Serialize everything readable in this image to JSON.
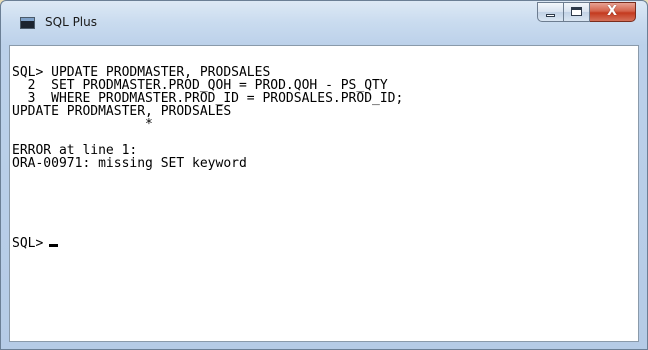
{
  "window": {
    "title": "SQL Plus",
    "app_icon": "console-window-icon",
    "controls": {
      "minimize_icon": "minimize-icon",
      "maximize_icon": "maximize-icon",
      "close_icon": "close-icon",
      "close_glyph": "X"
    }
  },
  "console": {
    "lines": [
      "SQL> UPDATE PRODMASTER, PRODSALES",
      "  2  SET PRODMASTER.PROD_QOH = PROD.QOH - PS_QTY",
      "  3  WHERE PRODMASTER.PROD_ID = PRODSALES.PROD_ID;",
      "UPDATE PRODMASTER, PRODSALES",
      "                 *",
      "",
      "ERROR at line 1:",
      "ORA-00971: missing SET keyword"
    ],
    "prompt": "SQL>"
  },
  "colors": {
    "console_background": "#ffffff",
    "console_text": "#000000",
    "close_button": "#c43a1f",
    "frame": "#b5cbe6"
  }
}
